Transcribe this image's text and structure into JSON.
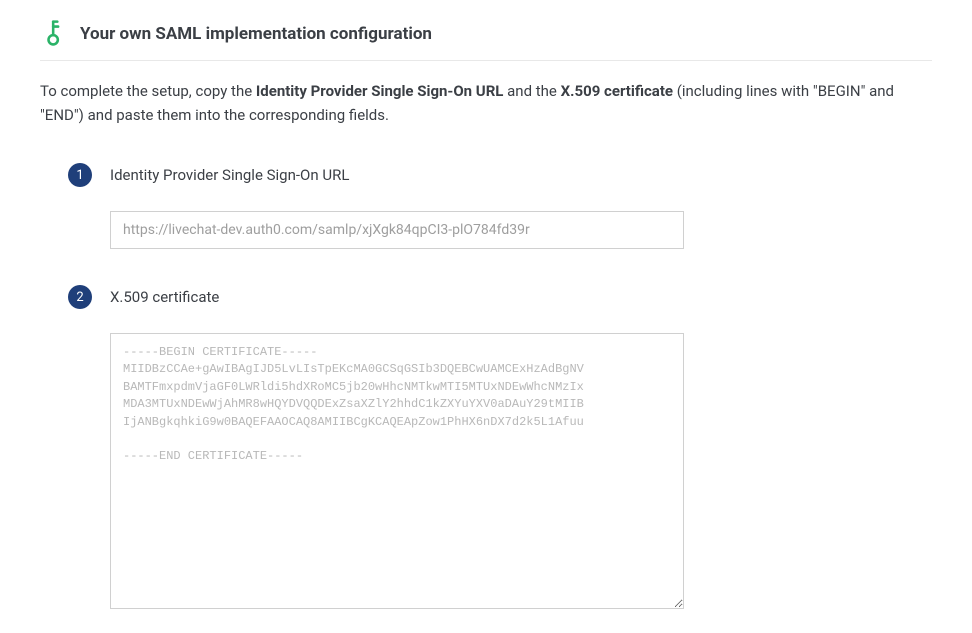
{
  "header": {
    "title": "Your own SAML implementation configuration"
  },
  "instructions": {
    "part1": "To complete the setup, copy the ",
    "bold1": "Identity Provider Single Sign-On URL",
    "part2": " and the ",
    "bold2": "X.509 certificate",
    "part3": " (including lines with \"BEGIN\" and \"END\") and paste them into the corresponding fields."
  },
  "steps": {
    "sso": {
      "num": "1",
      "label": "Identity Provider Single Sign-On URL",
      "value": "https://livechat-dev.auth0.com/samlp/xjXgk84qpCI3-plO784fd39r"
    },
    "cert": {
      "num": "2",
      "label": "X.509 certificate",
      "placeholder": "-----BEGIN CERTIFICATE-----\nMIIDBzCCAe+gAwIBAgIJD5LvLIsTpEKcMA0GCSqGSIb3DQEBCwUAMCExHzAdBgNV\nBAMTFmxpdmVjaGF0LWRldi5hdXRoMC5jb20wHhcNMTkwMTI5MTUxNDEwWhcNMzIx\nMDA3MTUxNDEwWjAhMR8wHQYDVQQDExZsaXZlY2hhdC1kZXYuYXV0aDAuY29tMIIB\nIjANBgkqhkiG9w0BAQEFAAOCAQ8AMIIBCgKCAQEApZow1PhHX6nDX7d2k5L1Afuu\n\n-----END CERTIFICATE-----"
    }
  }
}
